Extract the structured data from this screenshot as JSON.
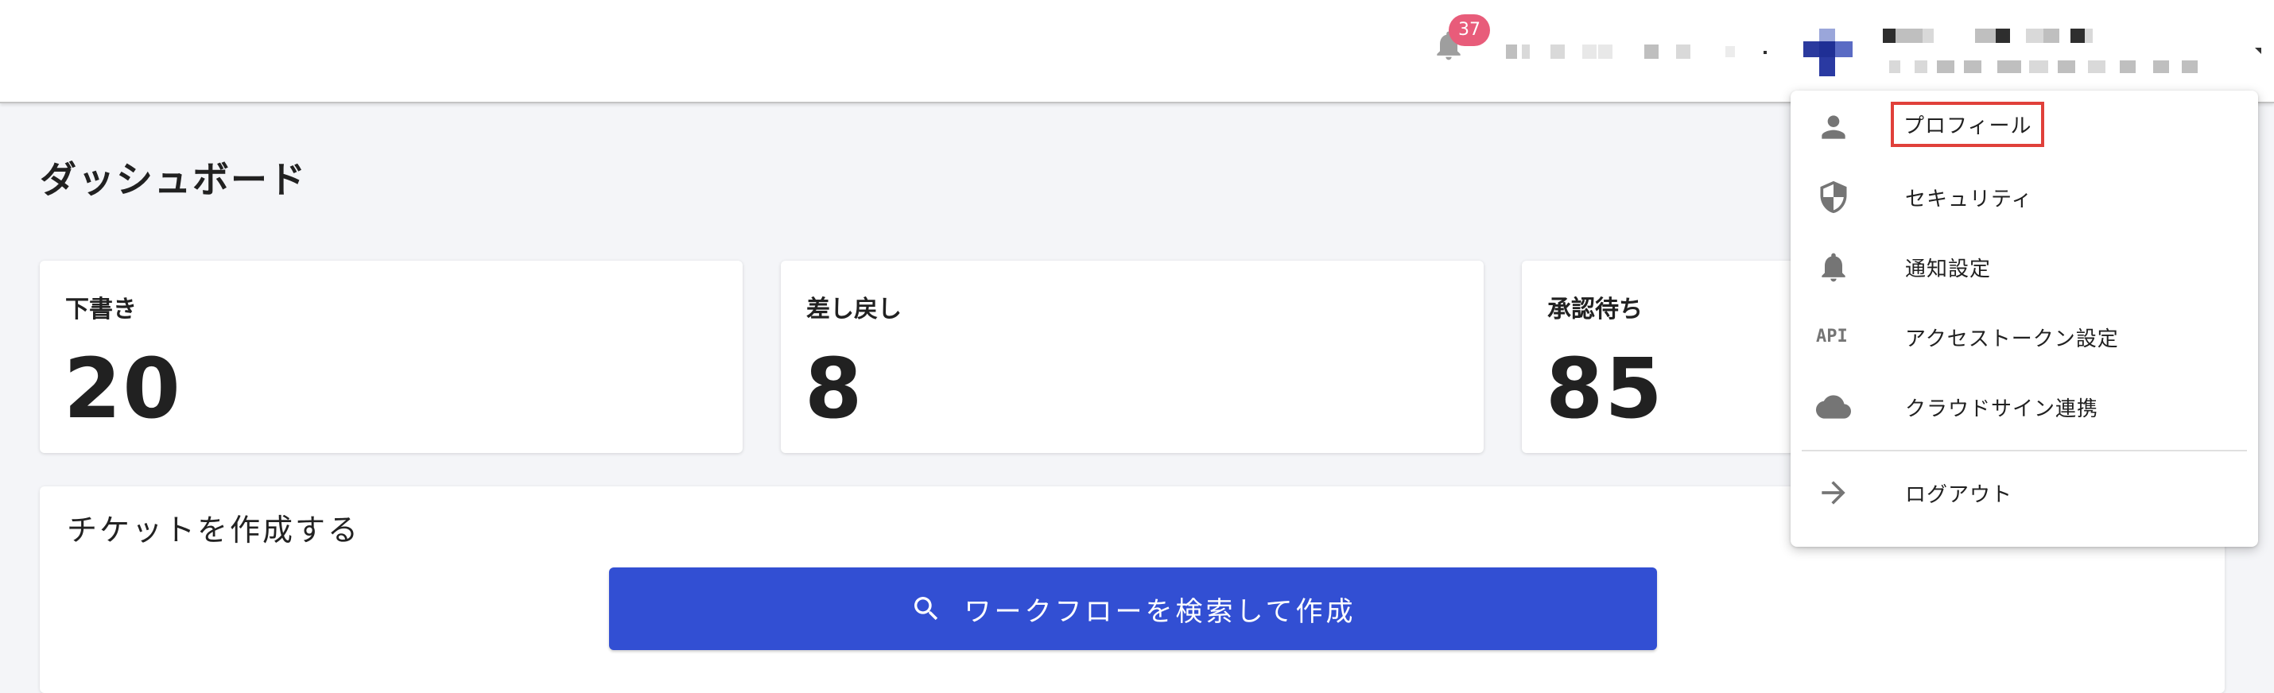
{
  "header": {
    "notification_count": "37",
    "user_name": "",
    "user_email": ""
  },
  "page_title": "ダッシュボード",
  "stats": [
    {
      "label": "下書き",
      "count": "20"
    },
    {
      "label": "差し戻し",
      "count": "8"
    },
    {
      "label": "承認待ち",
      "count": "85"
    }
  ],
  "ticket": {
    "heading": "チケットを作成する",
    "search_button_label": "ワークフローを検索して作成"
  },
  "user_menu": {
    "items": [
      {
        "label": "プロフィール",
        "icon": "person-icon"
      },
      {
        "label": "セキュリティ",
        "icon": "shield-icon"
      },
      {
        "label": "通知設定",
        "icon": "bell-icon"
      },
      {
        "label": "アクセストークン設定",
        "icon": "api-icon"
      },
      {
        "label": "クラウドサイン連携",
        "icon": "cloud-icon"
      },
      {
        "label": "ログアウト",
        "icon": "arrow-right-icon"
      }
    ],
    "api_icon_text": "API"
  },
  "colors": {
    "primary": "#324fd3",
    "badge": "#e85c7a",
    "highlight": "#e0403a",
    "icon_gray": "#757575"
  }
}
